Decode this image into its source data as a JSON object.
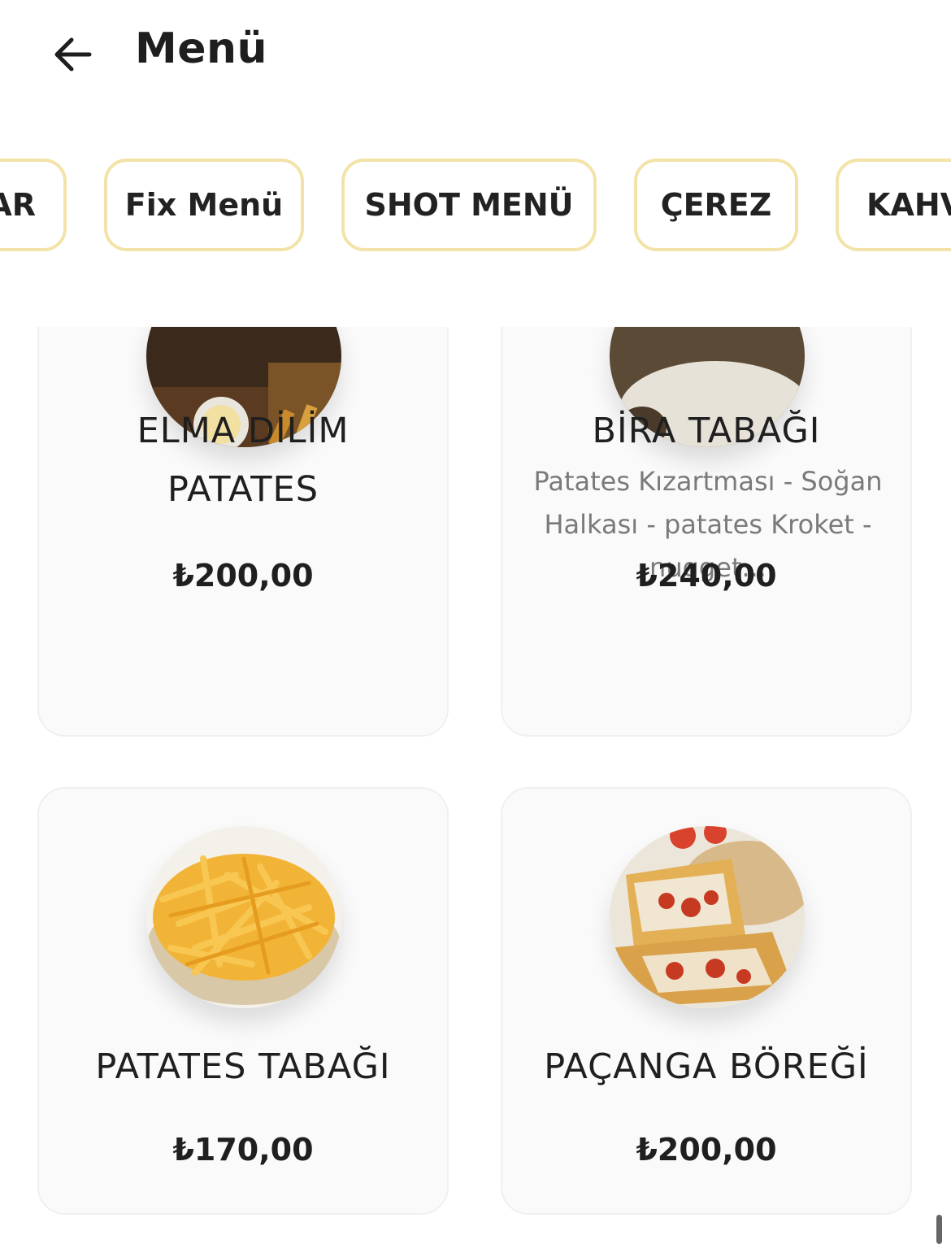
{
  "header": {
    "title": "Menü",
    "back_icon": "arrow-left-icon"
  },
  "categories": [
    {
      "label": "AR"
    },
    {
      "label": "Fix Menü"
    },
    {
      "label": "SHOT MENÜ"
    },
    {
      "label": "ÇEREZ"
    },
    {
      "label": "KAHV"
    }
  ],
  "colors": {
    "chip_border": "#f3e3a9",
    "card_bg": "#fafafa",
    "text": "#1f1f1f",
    "desc": "#7a7a7a"
  },
  "products": [
    {
      "name": "ELMA DİLİM PATATES",
      "description": "",
      "price": "₺200,00",
      "image": "fries-with-sauce-photo"
    },
    {
      "name": "BİRA TABAĞI",
      "description": "Patates Kızartması - Soğan Halkası - patates Kroket - nugget...",
      "price": "₺240,00",
      "image": "snack-platter-photo"
    },
    {
      "name": "PATATES TABAĞI",
      "description": "",
      "price": "₺170,00",
      "image": "french-fries-photo"
    },
    {
      "name": "PAÇANGA BÖREĞİ",
      "description": "",
      "price": "₺200,00",
      "image": "pacanga-borek-photo"
    }
  ]
}
